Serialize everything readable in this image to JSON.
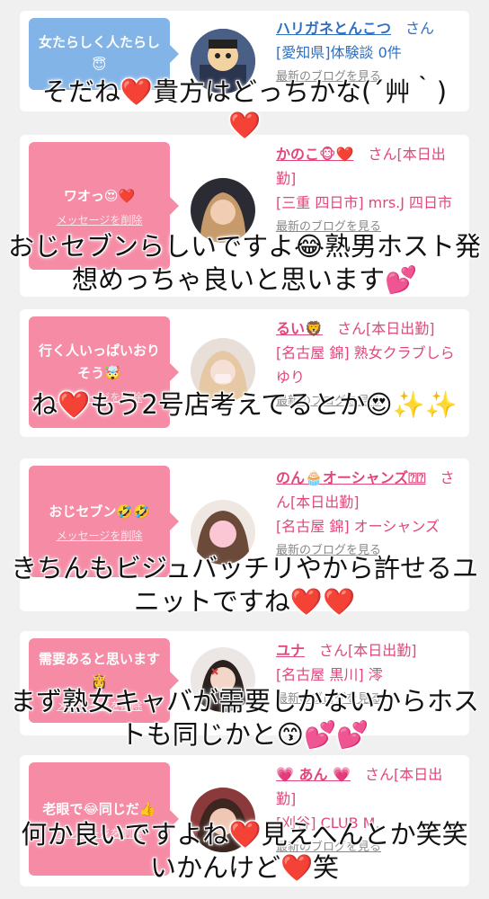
{
  "entries": [
    {
      "message": "女たらしく人たらし😇",
      "delete_label": "メッセージを削除",
      "name": "ハリガネとんこつ",
      "san": "さん",
      "details": "[愛知県]体験談 0件",
      "blog": "最新のブログを見る"
    },
    {
      "message": "ワオっ😍❤️",
      "delete_label": "メッセージを削除",
      "name": "かのこ🐵❤️",
      "san": "さん[本日出勤]",
      "details": "[三重 四日市] mrs.J 四日市",
      "blog": "最新のブログを見る"
    },
    {
      "message": "行く人いっぱいおりそう🤯",
      "delete_label": "メッセージを削除",
      "name": "るい🦁",
      "san": "さん[本日出勤]",
      "details": "[名古屋 錦] 熟女クラブしらゆり",
      "blog": "最新のブログを見る"
    },
    {
      "message": "おじセブン🤣🤣",
      "delete_label": "メッセージを削除",
      "name": "のん🧁オーシャンズ⍰⍰",
      "san": "さん[本日出勤]",
      "details": "[名古屋 錦] オーシャンズ",
      "blog": "最新のブログを見る"
    },
    {
      "message": "需要あると思います👸",
      "delete_label": "メッセージを削除",
      "name": "ユナ",
      "san": "さん[本日出勤]",
      "details": "[名古屋 黒川] 澪",
      "blog": "最新のブログを見る"
    },
    {
      "message": "老眼で😂同じだ👍",
      "delete_label": "メッセージを削除",
      "name": "💗 あん 💗",
      "san": "さん[本日出勤]",
      "details": "[刈谷] CLUB M.",
      "blog": "最新のブログを見る"
    }
  ],
  "overlays": [
    "そだね❤️貴方はどっちかな(´艸｀)❤️",
    "おじセブンらしいですよ😂熟男ホスト発想めっちゃ良いと思います💕",
    "ね❤️もう2号店考えてるとか😍✨✨",
    "きちんもビジュバッチリやから許せるユニットですね❤️❤️",
    "まず熟女キャバが需要しかないからホストも同じかと😙💕💕",
    "何か良いですよね❤️見えへんとか笑笑 いかんけど❤️笑"
  ]
}
